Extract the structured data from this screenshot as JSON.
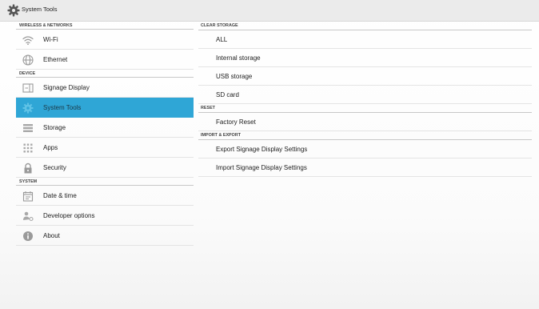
{
  "window": {
    "title": "System Tools"
  },
  "sidebar": {
    "sections": [
      {
        "header": "WIRELESS & NETWORKS",
        "items": [
          {
            "label": "Wi-Fi",
            "icon": "wifi-icon"
          },
          {
            "label": "Ethernet",
            "icon": "ethernet-icon"
          }
        ]
      },
      {
        "header": "DEVICE",
        "items": [
          {
            "label": "Signage Display",
            "icon": "display-icon"
          },
          {
            "label": "System Tools",
            "icon": "gear-icon",
            "selected": true
          },
          {
            "label": "Storage",
            "icon": "storage-icon"
          },
          {
            "label": "Apps",
            "icon": "apps-grid-icon"
          },
          {
            "label": "Security",
            "icon": "lock-icon"
          }
        ]
      },
      {
        "header": "SYSTEM",
        "items": [
          {
            "label": "Date & time",
            "icon": "calendar-icon"
          },
          {
            "label": "Developer options",
            "icon": "developer-icon"
          },
          {
            "label": "About",
            "icon": "info-icon"
          }
        ]
      }
    ]
  },
  "main": {
    "sections": [
      {
        "header": "CLEAR STORAGE",
        "items": [
          "ALL",
          "Internal storage",
          "USB storage",
          "SD card"
        ]
      },
      {
        "header": "RESET",
        "items": [
          "Factory Reset"
        ]
      },
      {
        "header": "IMPORT & EXPORT",
        "items": [
          "Export Signage Display Settings",
          "Import Signage Display Settings"
        ]
      }
    ]
  },
  "colors": {
    "selected_bg": "#2fa6d6",
    "titlebar_bg": "#ebebeb",
    "divider": "#e4e4e4"
  }
}
